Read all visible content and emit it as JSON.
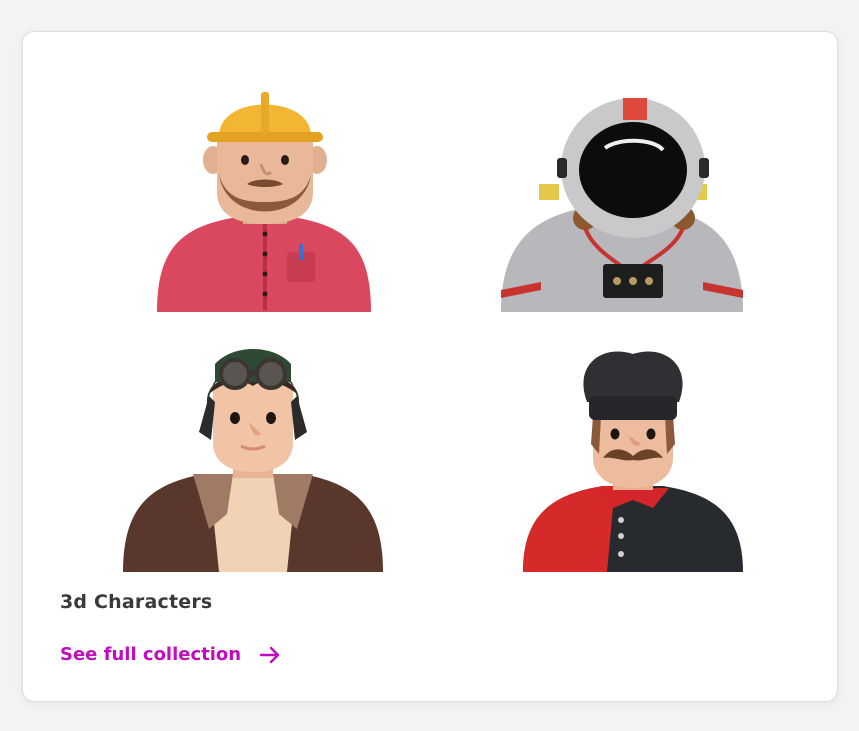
{
  "card": {
    "collection_title": "3d Characters",
    "link_label": "See full collection",
    "link_icon": "arrow-right-icon",
    "accent_color": "#c20cc0",
    "characters": [
      {
        "icon": "construction-worker-icon"
      },
      {
        "icon": "astronaut-icon"
      },
      {
        "icon": "aviator-icon"
      },
      {
        "icon": "chef-icon"
      }
    ]
  }
}
